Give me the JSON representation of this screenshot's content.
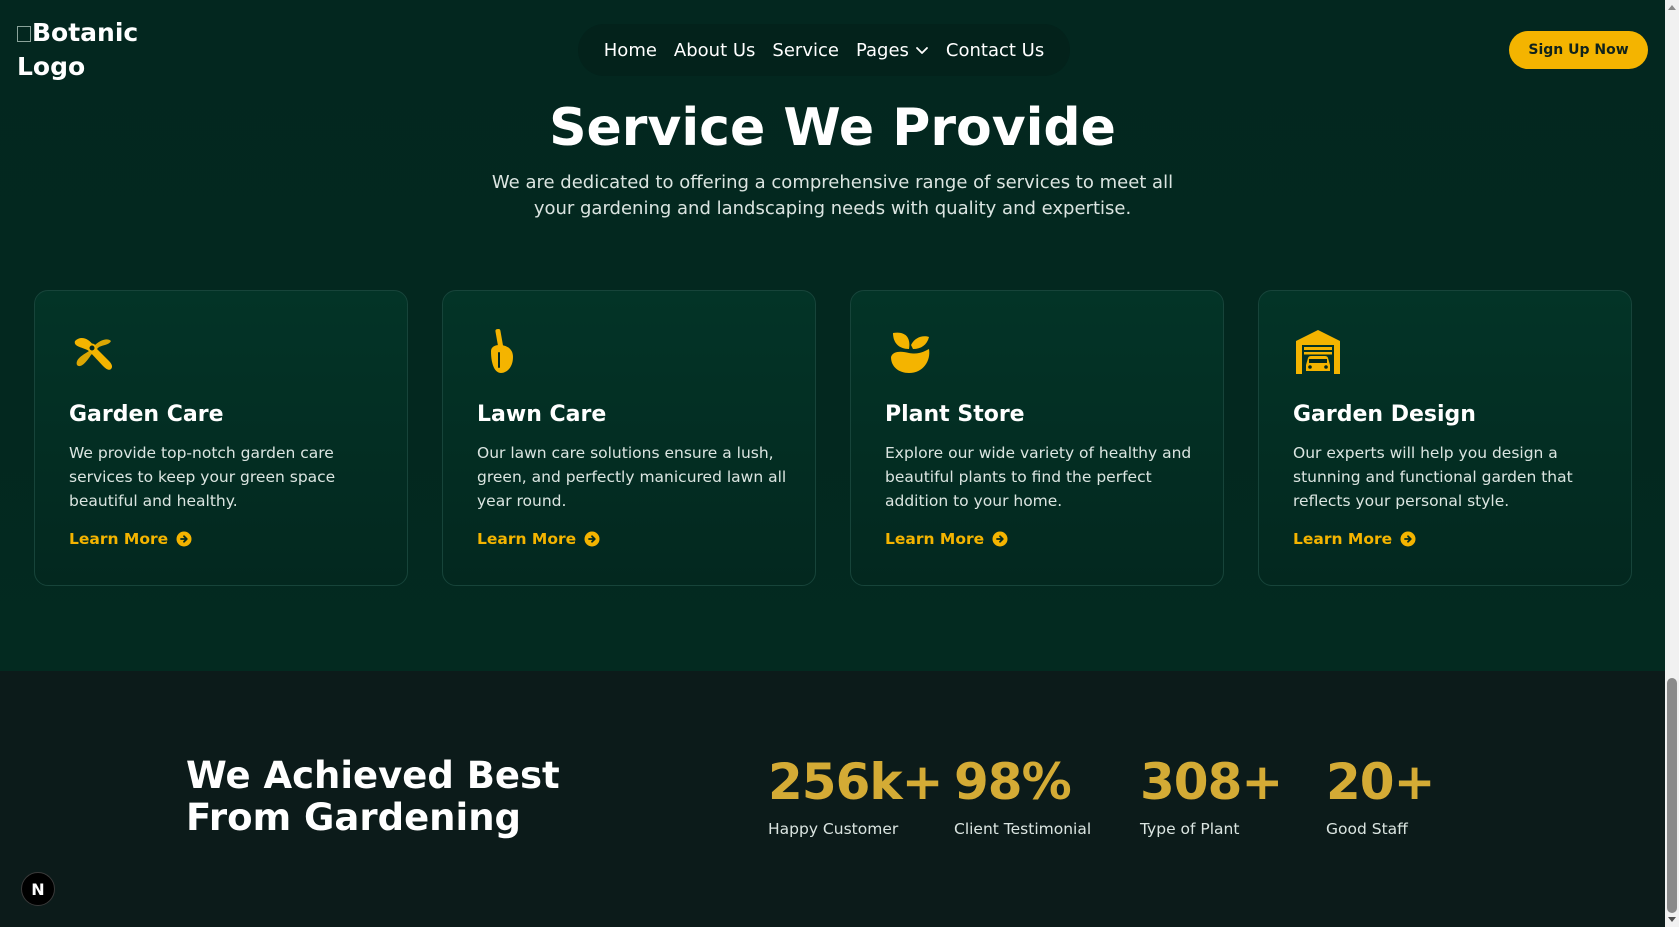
{
  "header": {
    "logo_alt": "Botanic Logo",
    "nav": [
      {
        "label": "Home"
      },
      {
        "label": "About Us"
      },
      {
        "label": "Service"
      },
      {
        "label": "Pages",
        "has_dropdown": true
      },
      {
        "label": "Contact Us"
      }
    ],
    "signup_label": "Sign Up Now"
  },
  "services": {
    "title": "Service We Provide",
    "description": "We are dedicated to offering a comprehensive range of services to meet all your gardening and landscaping needs with quality and expertise.",
    "cards": [
      {
        "icon": "pruning-shears-icon",
        "title": "Garden Care",
        "text": "We provide top-notch garden care services to keep your green space beautiful and healthy.",
        "link": "Learn More"
      },
      {
        "icon": "shovel-icon",
        "title": "Lawn Care",
        "text": "Our lawn care solutions ensure a lush, green, and perfectly manicured lawn all year round.",
        "link": "Learn More"
      },
      {
        "icon": "plant-pot-icon",
        "title": "Plant Store",
        "text": "Explore our wide variety of healthy and beautiful plants to find the perfect addition to your home.",
        "link": "Learn More"
      },
      {
        "icon": "garage-icon",
        "title": "Garden Design",
        "text": "Our experts will help you design a stunning and functional garden that reflects your personal style.",
        "link": "Learn More"
      }
    ]
  },
  "stats": {
    "heading": "We Achieved Best From Gardening",
    "items": [
      {
        "value": "256k+",
        "label": "Happy Customer"
      },
      {
        "value": "98%",
        "label": "Client Testimonial"
      },
      {
        "value": "308+",
        "label": "Type of Plant"
      },
      {
        "value": "20+",
        "label": "Good Staff"
      }
    ]
  },
  "badge": {
    "letter": "N"
  },
  "colors": {
    "accent": "#f4b400",
    "stat_value": "#d4ab35",
    "section_bg": "#03281f",
    "page_bg": "#0c1b1a"
  }
}
